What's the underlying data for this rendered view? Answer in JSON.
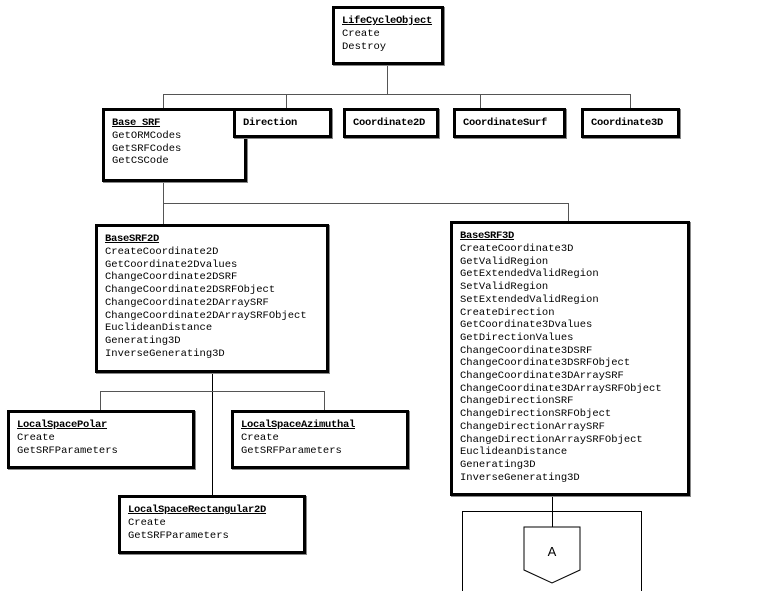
{
  "diagram": {
    "lifecycle": {
      "title": "LifeCycleObject",
      "methods": [
        "Create",
        "Destroy"
      ]
    },
    "base_srf": {
      "title": "Base SRF",
      "methods": [
        "GetORMCodes",
        "GetSRFCodes",
        "GetCSCode"
      ]
    },
    "direction": {
      "title": "Direction"
    },
    "coordinate2d": {
      "title": "Coordinate2D"
    },
    "coordinatesurf": {
      "title": "CoordinateSurf"
    },
    "coordinate3d": {
      "title": "Coordinate3D"
    },
    "base_srf_2d": {
      "title": "BaseSRF2D",
      "methods": [
        "CreateCoordinate2D",
        "GetCoordinate2Dvalues",
        "ChangeCoordinate2DSRF",
        "ChangeCoordinate2DSRFObject",
        "ChangeCoordinate2DArraySRF",
        "ChangeCoordinate2DArraySRFObject",
        "EuclideanDistance",
        "Generating3D",
        "InverseGenerating3D"
      ]
    },
    "base_srf_3d": {
      "title": "BaseSRF3D",
      "methods": [
        "CreateCoordinate3D",
        "GetValidRegion",
        "GetExtendedValidRegion",
        "SetValidRegion",
        "SetExtendedValidRegion",
        "CreateDirection",
        "GetCoordinate3Dvalues",
        "GetDirectionValues",
        "ChangeCoordinate3DSRF",
        "ChangeCoordinate3DSRFObject",
        "ChangeCoordinate3DArraySRF",
        "ChangeCoordinate3DArraySRFObject",
        "ChangeDirectionSRF",
        "ChangeDirectionSRFObject",
        "ChangeDirectionArraySRF",
        "ChangeDirectionArraySRFObject",
        "EuclideanDistance",
        "Generating3D",
        "InverseGenerating3D"
      ]
    },
    "local_space_polar": {
      "title": "LocalSpacePolar",
      "methods": [
        "Create",
        "GetSRFParameters"
      ]
    },
    "local_space_azimuthal": {
      "title": "LocalSpaceAzimuthal",
      "methods": [
        "Create",
        "GetSRFParameters"
      ]
    },
    "local_space_rectangular_2d": {
      "title": "LocalSpaceRectangular2D",
      "methods": [
        "Create",
        "GetSRFParameters"
      ]
    },
    "connector": {
      "label": "A"
    }
  }
}
